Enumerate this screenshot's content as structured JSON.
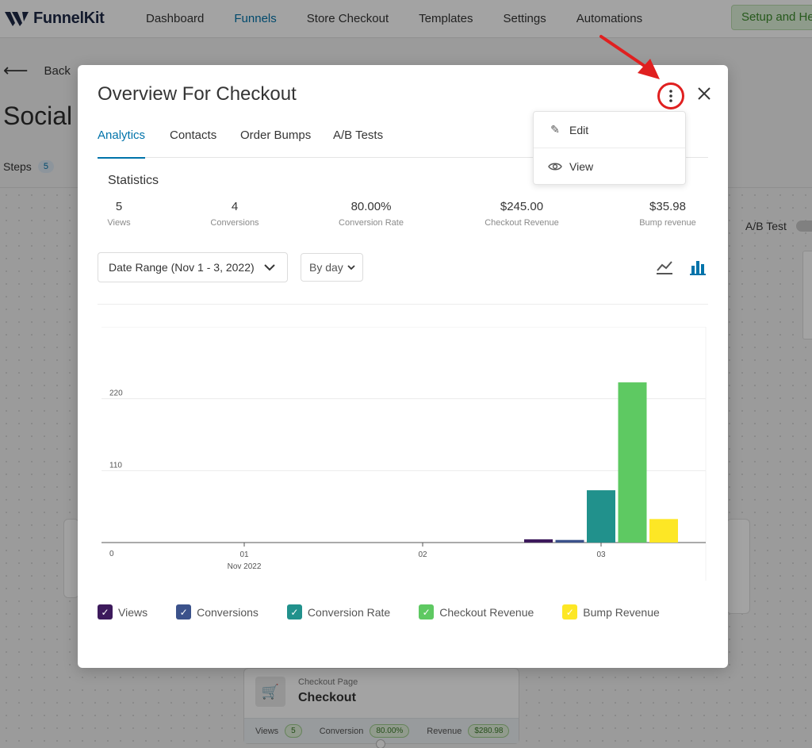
{
  "app": {
    "logo_text": "FunnelKit",
    "nav": [
      {
        "label": "Dashboard",
        "active": false
      },
      {
        "label": "Funnels",
        "active": true
      },
      {
        "label": "Store Checkout",
        "active": false
      },
      {
        "label": "Templates",
        "active": false
      },
      {
        "label": "Settings",
        "active": false
      },
      {
        "label": "Automations",
        "active": false
      }
    ],
    "setup_button": "Setup and He"
  },
  "background": {
    "back_label": "Back",
    "page_title": "Social M",
    "steps_label": "Steps",
    "steps_count": "5",
    "ab_test_label": "A/B Test",
    "checkout_card": {
      "subtitle": "Checkout Page",
      "title": "Checkout",
      "views_label": "Views",
      "views_value": "5",
      "conversion_label": "Conversion",
      "conversion_value": "80.00%",
      "revenue_label": "Revenue",
      "revenue_value": "$280.98"
    }
  },
  "modal": {
    "title": "Overview For Checkout",
    "tabs": [
      {
        "label": "Analytics",
        "active": true
      },
      {
        "label": "Contacts",
        "active": false
      },
      {
        "label": "Order Bumps",
        "active": false
      },
      {
        "label": "A/B Tests",
        "active": false
      }
    ],
    "statistics_label": "Statistics",
    "stats": [
      {
        "value": "5",
        "label": "Views"
      },
      {
        "value": "4",
        "label": "Conversions"
      },
      {
        "value": "80.00%",
        "label": "Conversion Rate"
      },
      {
        "value": "$245.00",
        "label": "Checkout Revenue"
      },
      {
        "value": "$35.98",
        "label": "Bump revenue"
      }
    ],
    "date_range": "Date Range (Nov 1 - 3, 2022)",
    "by_day": "By day",
    "menu": [
      {
        "label": "Edit",
        "icon": "pencil-icon"
      },
      {
        "label": "View",
        "icon": "eye-icon"
      }
    ]
  },
  "colors": {
    "accent": "#0073aa",
    "views": "#3d1a5c",
    "conversions": "#3b528b",
    "conversion_rate": "#21918c",
    "checkout_revenue": "#5ec962",
    "bump_revenue": "#fde725",
    "highlight_red": "#e02020"
  },
  "chart_data": {
    "type": "bar",
    "categories": [
      "01",
      "02",
      "03"
    ],
    "category_sublabels": [
      "Nov 2022",
      "",
      ""
    ],
    "yticks": [
      0,
      110,
      220,
      330
    ],
    "ylim": [
      0,
      330
    ],
    "series": [
      {
        "name": "Views",
        "values": [
          0,
          0,
          5
        ]
      },
      {
        "name": "Conversions",
        "values": [
          0,
          0,
          4
        ]
      },
      {
        "name": "Conversion Rate",
        "values": [
          0,
          0,
          80
        ]
      },
      {
        "name": "Checkout Revenue",
        "values": [
          0,
          0,
          245
        ]
      },
      {
        "name": "Bump Revenue",
        "values": [
          0,
          0,
          35.98
        ]
      }
    ],
    "grid": true,
    "legend_position": "bottom-left"
  }
}
